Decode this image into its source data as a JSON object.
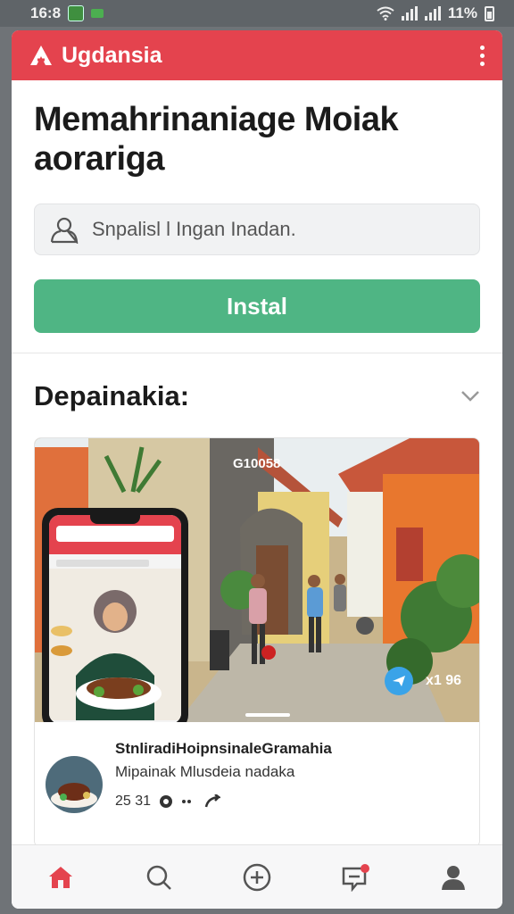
{
  "status_bar": {
    "time": "16:8",
    "battery": "11%",
    "icons": [
      "app-notification-icon",
      "signal-icon",
      "wifi-icon",
      "cell-signal-icon",
      "battery-icon"
    ]
  },
  "app_bar": {
    "brand_name": "Ugdansia",
    "brand_icon": "logo-icon",
    "menu_icon": "more-vertical-icon",
    "color": "#e4434e"
  },
  "headline": "Memahrinaniage Moiak aorariga",
  "search": {
    "placeholder": "Snpalisl l Ingan Inadan.",
    "icon": "user-icon"
  },
  "install_button": {
    "label": "Instal",
    "color": "#4fb584"
  },
  "section": {
    "title": "Depainakia:",
    "toggle_icon": "chevron-down-icon"
  },
  "feed_card": {
    "media_counter": "G10058",
    "media_stat": "x1 96",
    "share_icon": "send-icon",
    "post": {
      "title": "StnliradiHoipnsinaleGramahia",
      "subtitle": "Mipainak Mlusdeia nadaka",
      "time": "25 31",
      "meta_icons": [
        "comment-icon",
        "more-horizontal-icon",
        "share-icon"
      ]
    }
  },
  "tab_bar": {
    "items": [
      {
        "name": "home",
        "icon": "home-icon",
        "active": true
      },
      {
        "name": "search",
        "icon": "search-icon",
        "active": false
      },
      {
        "name": "create",
        "icon": "plus-circle-icon",
        "active": false
      },
      {
        "name": "messages",
        "icon": "message-icon",
        "active": false,
        "badge": true
      },
      {
        "name": "profile",
        "icon": "profile-icon",
        "active": false
      }
    ],
    "active_color": "#e4434e"
  }
}
